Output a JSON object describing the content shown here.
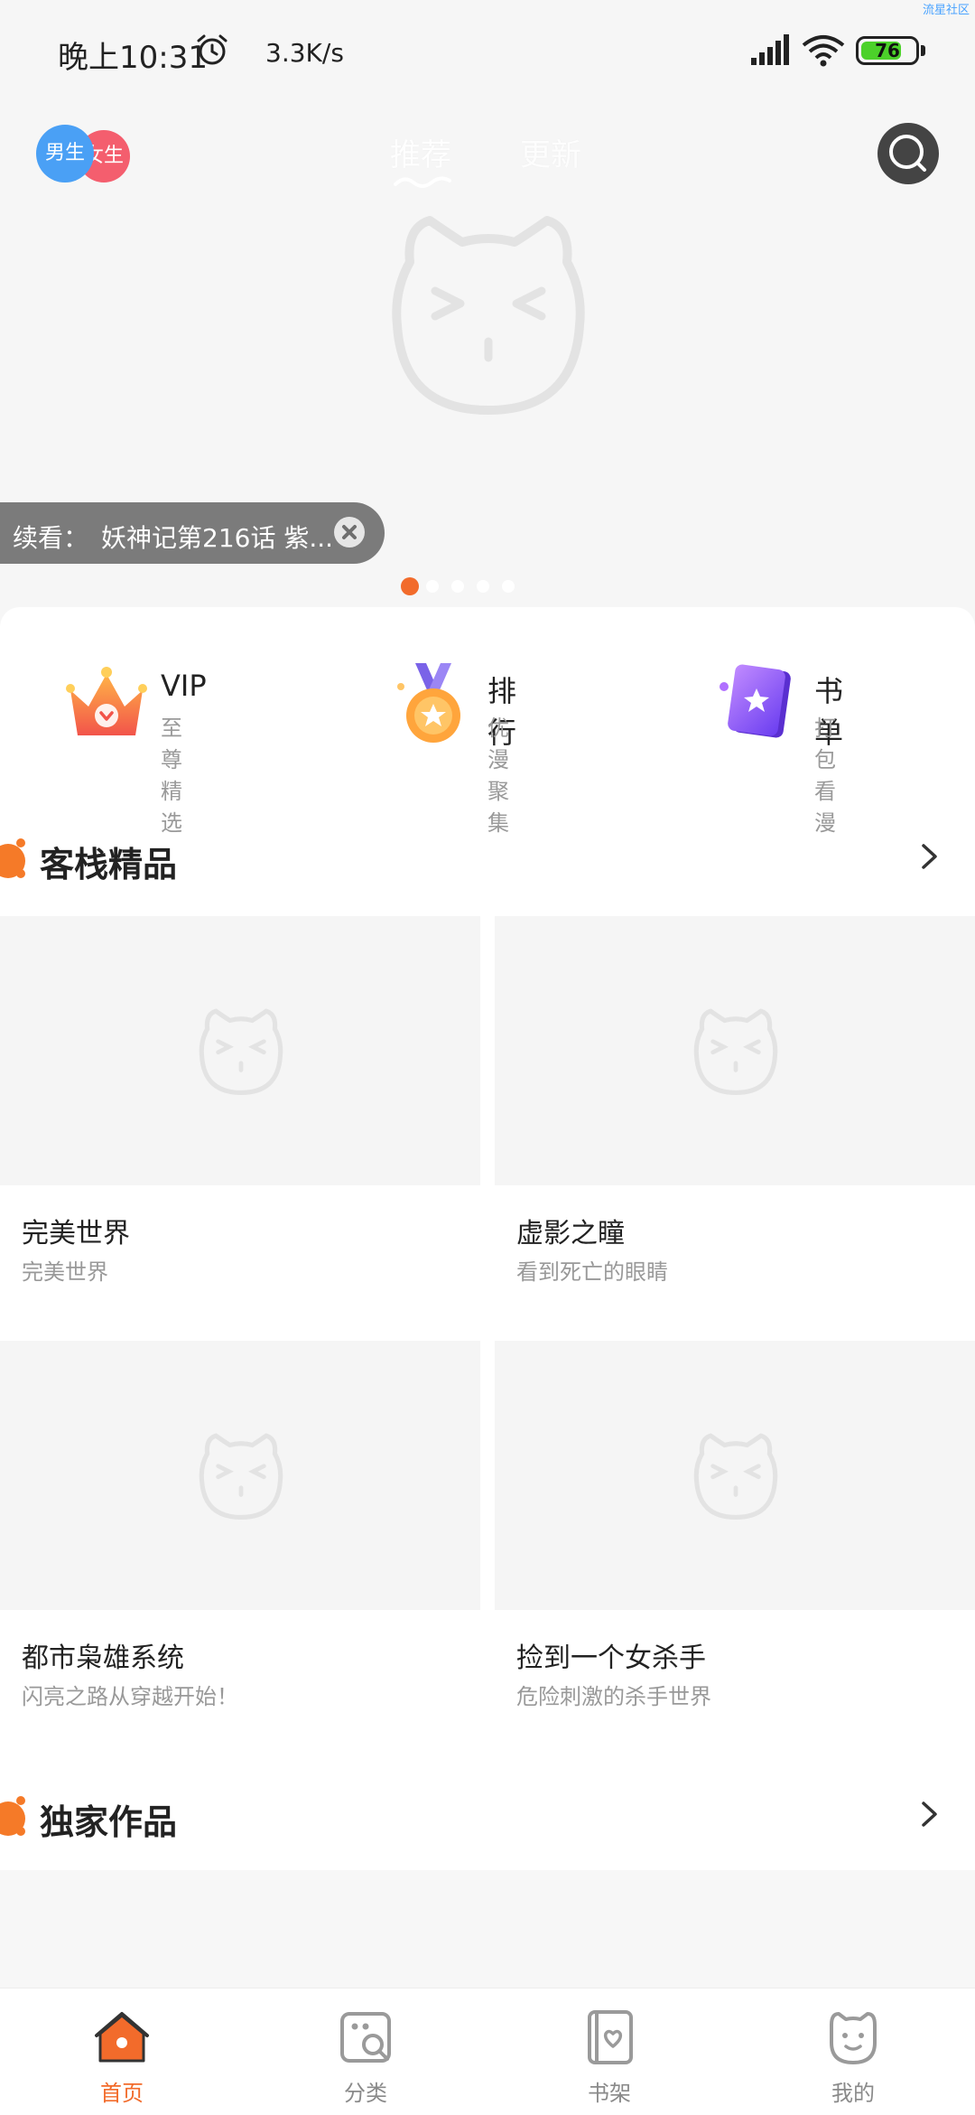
{
  "status_bar": {
    "time": "晚上10:31",
    "net_speed": "3.3K/s",
    "battery": "76",
    "battery_level": 0.76,
    "watermark": "流星社区"
  },
  "header": {
    "gender_male": "男生",
    "gender_female": "女生",
    "tabs": [
      {
        "label": "推荐",
        "active": true
      },
      {
        "label": "更新",
        "active": false
      }
    ]
  },
  "banner": {
    "continue_label": "续看：",
    "continue_title": "妖神记第216话 紫...",
    "dot_count": 5,
    "active_dot": 0
  },
  "quick_links": [
    {
      "title": "VIP",
      "subtitle": "至尊精选",
      "icon": "crown-icon"
    },
    {
      "title": "排行",
      "subtitle": "优漫聚集",
      "icon": "medal-icon"
    },
    {
      "title": "书单",
      "subtitle": "打包看漫",
      "icon": "book-icon"
    }
  ],
  "sections": [
    {
      "title": "客栈精品",
      "items": [
        {
          "title": "完美世界",
          "subtitle": "完美世界"
        },
        {
          "title": "虚影之瞳",
          "subtitle": "看到死亡的眼睛"
        },
        {
          "title": "都市枭雄系统",
          "subtitle": "闪亮之路从穿越开始！"
        },
        {
          "title": "捡到一个女杀手",
          "subtitle": "危险刺激的杀手世界"
        }
      ]
    },
    {
      "title": "独家作品",
      "items": []
    }
  ],
  "bottom_nav": [
    {
      "label": "首页",
      "icon": "home-icon",
      "active": true
    },
    {
      "label": "分类",
      "icon": "category-icon",
      "active": false
    },
    {
      "label": "书架",
      "icon": "bookshelf-icon",
      "active": false
    },
    {
      "label": "我的",
      "icon": "profile-icon",
      "active": false
    }
  ],
  "colors": {
    "accent": "#f26b2b",
    "male": "#4aa0f5",
    "female": "#f45e6e"
  }
}
